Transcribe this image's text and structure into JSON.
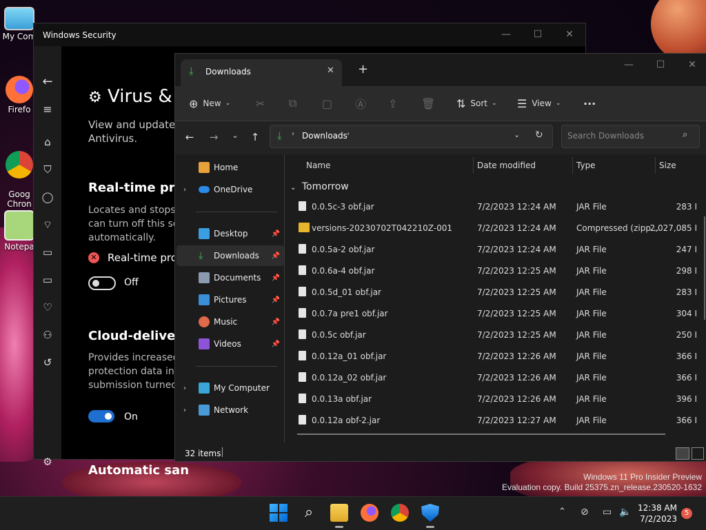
{
  "desktop": {
    "icons": [
      {
        "label": "My Com",
        "color": "#5fc0ea"
      },
      {
        "label": "Firefo",
        "color": "#ff7139"
      },
      {
        "label": "Goog\nChron",
        "color": "#4285f4"
      },
      {
        "label": "Notepa",
        "color": "#8fcf6a"
      }
    ],
    "watermark_line1": "Windows 11 Pro Insider Preview",
    "watermark_line2": "Evaluation copy. Build 25375.zn_release.230520-1632"
  },
  "security": {
    "title": "Windows Security",
    "heading": "Virus &",
    "subtitle": "View and update V\nAntivirus.",
    "rtp_heading": "Real-time prot",
    "rtp_desc": "Locates and stops r\ncan turn off this set\nautomatically.",
    "rtp_status": "Real-time prote",
    "rtp_toggle_label": "Off",
    "cloud_heading": "Cloud-delivere",
    "cloud_desc": "Provides increased\nprotection data in t\nsubmission turned",
    "cloud_toggle_label": "On",
    "auto_heading": "Automatic san"
  },
  "explorer": {
    "tab_title": "Downloads",
    "new_tab": "+",
    "toolbar": {
      "new": "New",
      "sort": "Sort",
      "view": "View",
      "more": "···"
    },
    "address": {
      "segment": "Downloads"
    },
    "search_placeholder": "Search Downloads",
    "sidebar": {
      "home": "Home",
      "onedrive": "OneDrive",
      "desktop": "Desktop",
      "downloads": "Downloads",
      "documents": "Documents",
      "pictures": "Pictures",
      "music": "Music",
      "videos": "Videos",
      "mycomputer": "My Computer",
      "network": "Network"
    },
    "columns": {
      "name": "Name",
      "date": "Date modified",
      "type": "Type",
      "size": "Size"
    },
    "group_label": "Tomorrow",
    "files": [
      {
        "name": "0.0.5c-3 obf.jar",
        "date": "7/2/2023 12:24 AM",
        "type": "JAR File",
        "size": "283 I",
        "kind": "file"
      },
      {
        "name": "versions-20230702T042210Z-001",
        "date": "7/2/2023 12:24 AM",
        "type": "Compressed (zipp...",
        "size": "2,027,085 I",
        "kind": "zip"
      },
      {
        "name": "0.0.5a-2 obf.jar",
        "date": "7/2/2023 12:24 AM",
        "type": "JAR File",
        "size": "247 I",
        "kind": "file"
      },
      {
        "name": "0.0.6a-4 obf.jar",
        "date": "7/2/2023 12:25 AM",
        "type": "JAR File",
        "size": "298 I",
        "kind": "file"
      },
      {
        "name": "0.0.5d_01 obf.jar",
        "date": "7/2/2023 12:25 AM",
        "type": "JAR File",
        "size": "283 I",
        "kind": "file"
      },
      {
        "name": "0.0.7a pre1 obf.jar",
        "date": "7/2/2023 12:25 AM",
        "type": "JAR File",
        "size": "304 I",
        "kind": "file"
      },
      {
        "name": "0.0.5c obf.jar",
        "date": "7/2/2023 12:25 AM",
        "type": "JAR File",
        "size": "250 I",
        "kind": "file"
      },
      {
        "name": "0.0.12a_01 obf.jar",
        "date": "7/2/2023 12:26 AM",
        "type": "JAR File",
        "size": "366 I",
        "kind": "file"
      },
      {
        "name": "0.0.12a_02 obf.jar",
        "date": "7/2/2023 12:26 AM",
        "type": "JAR File",
        "size": "366 I",
        "kind": "file"
      },
      {
        "name": "0.0.13a obf.jar",
        "date": "7/2/2023 12:26 AM",
        "type": "JAR File",
        "size": "396 I",
        "kind": "file"
      },
      {
        "name": "0.0.12a obf-2.jar",
        "date": "7/2/2023 12:27 AM",
        "type": "JAR File",
        "size": "366 I",
        "kind": "file"
      }
    ],
    "status": "32 items"
  },
  "taskbar": {
    "time": "12:38 AM",
    "date": "7/2/2023",
    "notification_count": "5"
  },
  "colors": {
    "accent": "#1e6fd0",
    "download_green": "#3fb950",
    "folder_yellow": "#e8b62c"
  }
}
